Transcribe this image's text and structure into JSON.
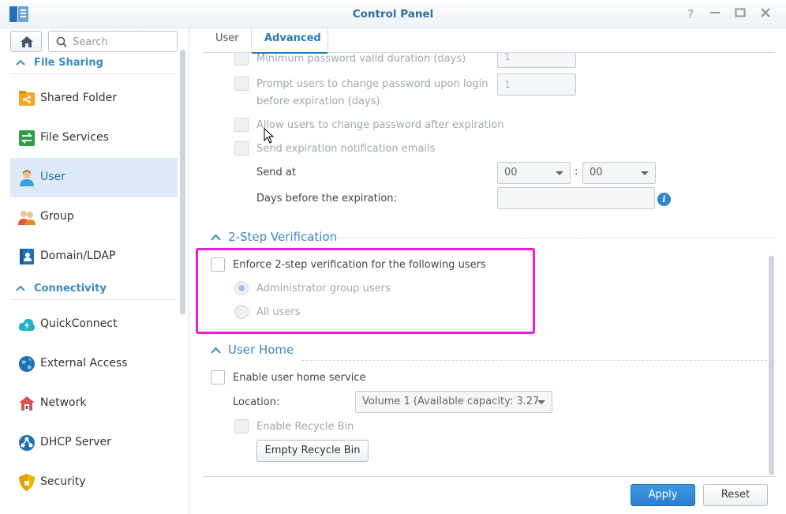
{
  "window": {
    "title": "Control Panel",
    "controls": [
      "help-icon",
      "minimize-icon",
      "maximize-icon",
      "close-icon"
    ]
  },
  "sidebar": {
    "search_placeholder": "Search",
    "categories": [
      {
        "label": "File Sharing"
      },
      {
        "label": "Connectivity"
      }
    ],
    "items": [
      {
        "label": "Shared Folder",
        "icon": "shared-folder-icon"
      },
      {
        "label": "File Services",
        "icon": "file-services-icon"
      },
      {
        "label": "User",
        "icon": "user-icon",
        "active": true
      },
      {
        "label": "Group",
        "icon": "group-icon"
      },
      {
        "label": "Domain/LDAP",
        "icon": "domain-ldap-icon"
      },
      {
        "label": "QuickConnect",
        "icon": "quickconnect-icon"
      },
      {
        "label": "External Access",
        "icon": "external-access-icon"
      },
      {
        "label": "Network",
        "icon": "network-icon"
      },
      {
        "label": "DHCP Server",
        "icon": "dhcp-server-icon"
      },
      {
        "label": "Security",
        "icon": "security-icon"
      }
    ]
  },
  "tabs": [
    {
      "label": "User"
    },
    {
      "label": "Advanced",
      "active": true
    }
  ],
  "password_expiry": {
    "min_duration_label": "Minimum password valid duration (days)",
    "min_duration_value": "1",
    "prompt_label_line1": "Prompt users to change password upon login",
    "prompt_label_line2": "before expiration (days)",
    "prompt_value": "1",
    "allow_change_label": "Allow users to change password after expiration",
    "send_notification_label": "Send expiration notification emails",
    "send_at_label": "Send at",
    "send_at_hour": "00",
    "send_at_sep": ":",
    "send_at_minute": "00",
    "days_before_label": "Days before the expiration:",
    "days_before_value": "",
    "info_glyph": "i"
  },
  "two_step": {
    "heading": "2-Step Verification",
    "enforce_label": "Enforce 2-step verification for the following users",
    "admin_option": "Administrator group users",
    "all_option": "All users"
  },
  "user_home": {
    "heading": "User Home",
    "enable_label": "Enable user home service",
    "location_label": "Location:",
    "location_value": "Volume 1 (Available capacity: 3.27",
    "recycle_label": "Enable Recycle Bin",
    "empty_button": "Empty Recycle Bin"
  },
  "footer": {
    "apply": "Apply",
    "reset": "Reset"
  },
  "colors": {
    "accent": "#2a7ab8",
    "highlight": "#e51fcf",
    "active_nav": "#dcebf7"
  }
}
